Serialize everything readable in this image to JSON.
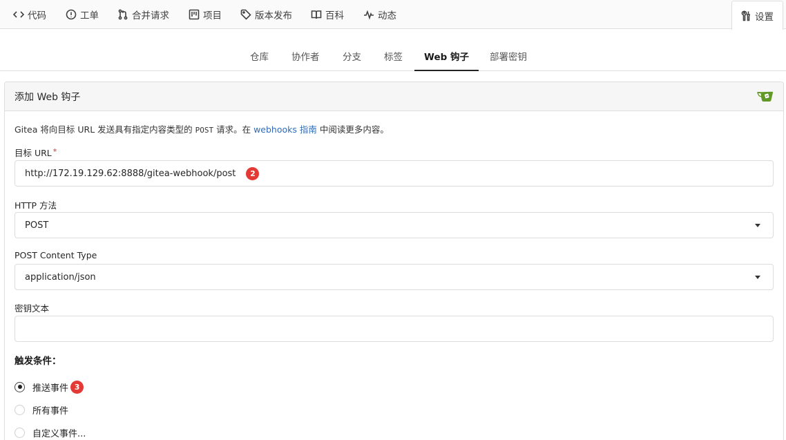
{
  "repo_tabs": [
    {
      "label": "代码",
      "icon": "code-icon"
    },
    {
      "label": "工单",
      "icon": "issue-icon"
    },
    {
      "label": "合并请求",
      "icon": "pull-request-icon"
    },
    {
      "label": "项目",
      "icon": "project-icon"
    },
    {
      "label": "版本发布",
      "icon": "tag-icon"
    },
    {
      "label": "百科",
      "icon": "book-icon"
    },
    {
      "label": "动态",
      "icon": "pulse-icon"
    },
    {
      "label": "设置",
      "icon": "tools-icon",
      "active": true
    }
  ],
  "settings_nav": [
    {
      "label": "仓库"
    },
    {
      "label": "协作者"
    },
    {
      "label": "分支"
    },
    {
      "label": "标签"
    },
    {
      "label": "Web 钩子",
      "active": true
    },
    {
      "label": "部署密钥"
    }
  ],
  "card": {
    "title": "添加 Web 钩子",
    "logo_icon": "gitea-logo-icon",
    "brand_color": "#609926"
  },
  "description": {
    "before": "Gitea 将向目标 URL 发送具有指定内容类型的 ",
    "mono": "POST",
    "middle": " 请求。在 ",
    "link": "webhooks 指南",
    "after": " 中阅读更多内容。"
  },
  "form": {
    "target_url_label": "目标 URL",
    "required_mark": "*",
    "target_url_value": "http://172.19.129.62:8888/gitea-webhook/post",
    "target_url_badge": "2",
    "http_method_label": "HTTP 方法",
    "http_method_value": "POST",
    "content_type_label": "POST Content Type",
    "content_type_value": "application/json",
    "secret_label": "密钥文本",
    "secret_value": ""
  },
  "trigger": {
    "title": "触发条件：",
    "options": [
      {
        "label": "推送事件",
        "checked": true,
        "badge": "3"
      },
      {
        "label": "所有事件",
        "checked": false
      },
      {
        "label": "自定义事件...",
        "checked": false
      }
    ]
  },
  "colors": {
    "badge": "#e53935",
    "link": "#2e6bb5"
  }
}
